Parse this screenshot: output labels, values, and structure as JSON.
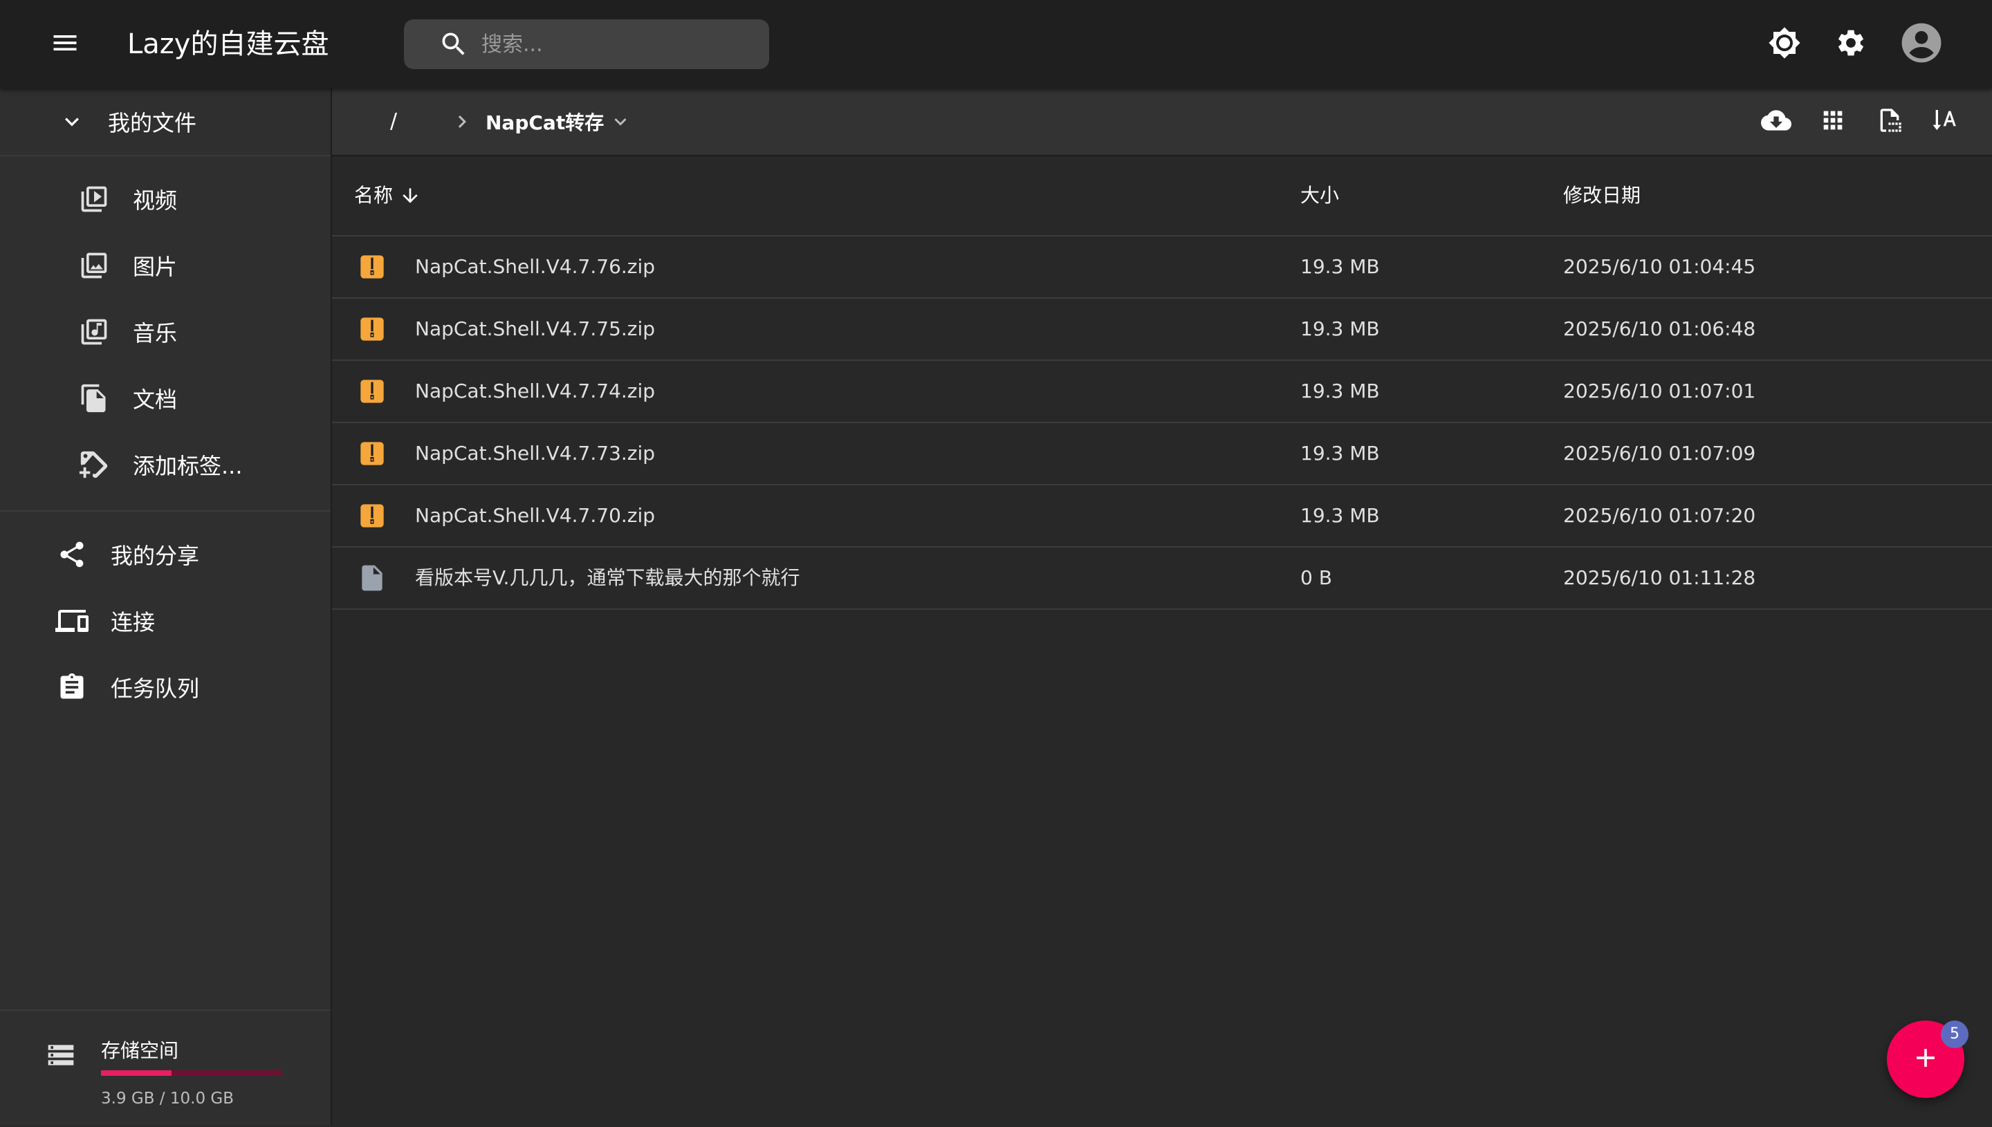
{
  "appbar": {
    "title": "Lazy的自建云盘",
    "search_placeholder": "搜索...",
    "icons": [
      "menu-icon",
      "search-icon",
      "brightness-icon",
      "gear-icon",
      "account-circle-icon"
    ]
  },
  "sidebar": {
    "header_label": "我的文件",
    "sub_items": [
      {
        "label": "视频",
        "icon": "video-library-icon"
      },
      {
        "label": "图片",
        "icon": "photo-library-icon"
      },
      {
        "label": "音乐",
        "icon": "music-library-icon"
      },
      {
        "label": "文档",
        "icon": "documents-icon"
      },
      {
        "label": "添加标签...",
        "icon": "add-tag-icon"
      }
    ],
    "top_items": [
      {
        "label": "我的分享",
        "icon": "share-icon"
      },
      {
        "label": "连接",
        "icon": "devices-icon"
      },
      {
        "label": "任务队列",
        "icon": "clipboard-list-icon"
      }
    ],
    "storage": {
      "label": "存储空间",
      "used_text": "3.9 GB / 10.0 GB",
      "used_fraction": 0.39
    }
  },
  "toolbar": {
    "breadcrumb_root": "/",
    "breadcrumb_current": "NapCat转存",
    "icons": [
      "cloud-download-icon",
      "grid-view-icon",
      "select-area-icon",
      "sort-alpha-icon"
    ]
  },
  "table": {
    "headers": {
      "name": "名称",
      "size": "大小",
      "date": "修改日期"
    },
    "rows": [
      {
        "name": "NapCat.Shell.V4.7.76.zip",
        "size": "19.3 MB",
        "date": "2025/6/10 01:04:45",
        "type": "zip"
      },
      {
        "name": "NapCat.Shell.V4.7.75.zip",
        "size": "19.3 MB",
        "date": "2025/6/10 01:06:48",
        "type": "zip"
      },
      {
        "name": "NapCat.Shell.V4.7.74.zip",
        "size": "19.3 MB",
        "date": "2025/6/10 01:07:01",
        "type": "zip"
      },
      {
        "name": "NapCat.Shell.V4.7.73.zip",
        "size": "19.3 MB",
        "date": "2025/6/10 01:07:09",
        "type": "zip"
      },
      {
        "name": "NapCat.Shell.V4.7.70.zip",
        "size": "19.3 MB",
        "date": "2025/6/10 01:07:20",
        "type": "zip"
      },
      {
        "name": "看版本号V.几几几，通常下载最大的那个就行",
        "size": "0 B",
        "date": "2025/6/10 01:11:28",
        "type": "text"
      }
    ]
  },
  "fab": {
    "badge": "5",
    "icon": "plus-icon"
  },
  "colors": {
    "appbar": "#1f1f1f",
    "sidebar": "#2f2f2f",
    "main": "#282828",
    "accent": "#f50057",
    "zip_icon": "#f5a73b",
    "badge": "#5c6bc0"
  }
}
